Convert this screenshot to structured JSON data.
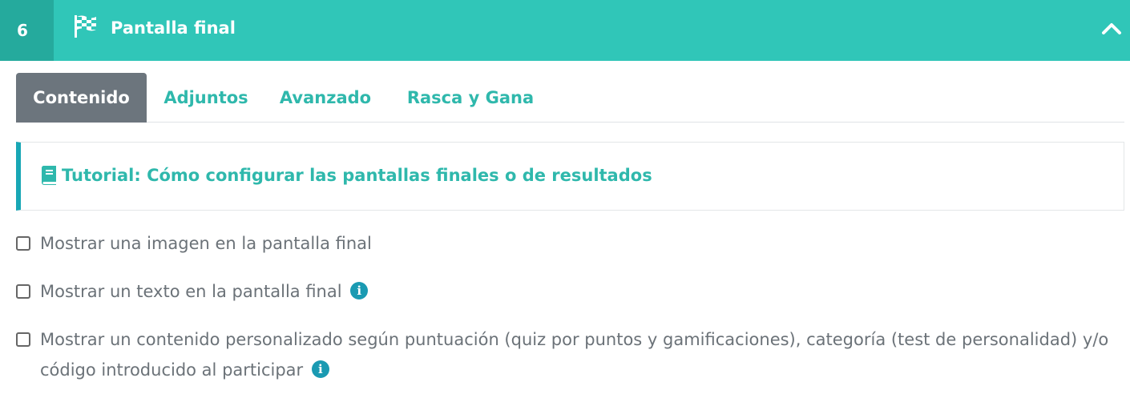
{
  "header": {
    "step_number": "6",
    "icon": "checkered-flag-icon",
    "title": "Pantalla final",
    "collapse_icon": "chevron-up-icon",
    "colors": {
      "bar": "#30c6b8",
      "step_bg": "#25aa9d"
    }
  },
  "tabs": [
    {
      "label": "Contenido",
      "active": true
    },
    {
      "label": "Adjuntos",
      "active": false
    },
    {
      "label": "Avanzado",
      "active": false
    },
    {
      "label": "Rasca y Gana",
      "active": false
    }
  ],
  "tutorial": {
    "icon": "book-icon",
    "label": "Tutorial: Cómo configurar las pantallas finales o de resultados"
  },
  "options": [
    {
      "label": "Mostrar una imagen en la pantalla final",
      "checked": false,
      "info": false
    },
    {
      "label": "Mostrar un texto en la pantalla final",
      "checked": false,
      "info": true
    },
    {
      "label": "Mostrar un contenido personalizado según puntuación (quiz por puntos y gamificaciones), categoría (test de personalidad) y/o código introducido al participar",
      "checked": false,
      "info": true
    }
  ],
  "info_icon": {
    "icon": "info-icon",
    "glyph": "i"
  }
}
